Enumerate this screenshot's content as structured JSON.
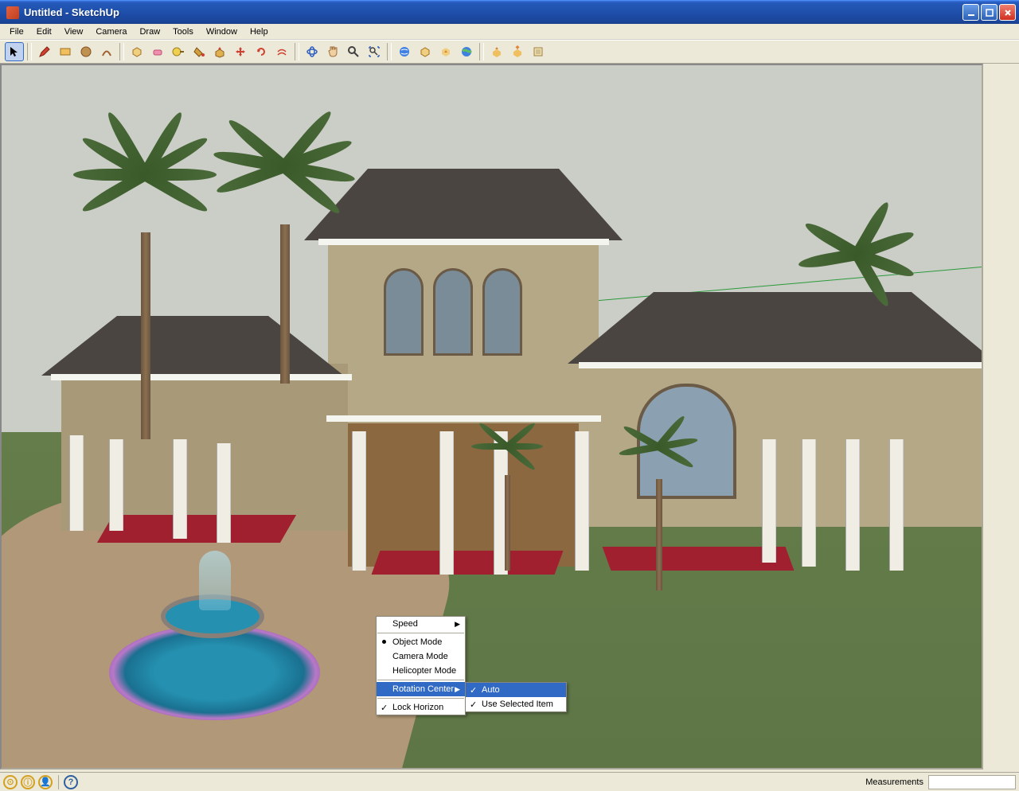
{
  "titlebar": {
    "text": "Untitled - SketchUp"
  },
  "menubar": [
    "File",
    "Edit",
    "View",
    "Camera",
    "Draw",
    "Tools",
    "Window",
    "Help"
  ],
  "toolbar_icons": [
    "select-tool",
    "pencil-tool",
    "rectangle-tool",
    "circle-tool",
    "arc-tool",
    "make-component-tool",
    "eraser-tool",
    "tape-measure-tool",
    "paint-bucket-tool",
    "push-pull-tool",
    "move-tool",
    "rotate-tool",
    "offset-tool",
    "orbit-tool",
    "pan-tool",
    "zoom-tool",
    "zoom-extents-tool",
    "get-models-tool",
    "previous-view-tool",
    "next-view-tool",
    "google-earth-tool",
    "share-model-tool",
    "export-tool",
    "import-tool"
  ],
  "context_menu": {
    "items": [
      {
        "label": "Speed",
        "submenu": true
      },
      {
        "label": "Object Mode",
        "bullet": true
      },
      {
        "label": "Camera Mode"
      },
      {
        "label": "Helicopter Mode"
      },
      {
        "label": "Rotation Center",
        "submenu": true,
        "highlighted": true
      },
      {
        "label": "Lock Horizon",
        "checked": true
      }
    ],
    "submenu_items": [
      {
        "label": "Auto",
        "checked": true,
        "highlighted": true
      },
      {
        "label": "Use Selected Item",
        "checked": true
      }
    ]
  },
  "statusbar": {
    "measurements_label": "Measurements"
  }
}
